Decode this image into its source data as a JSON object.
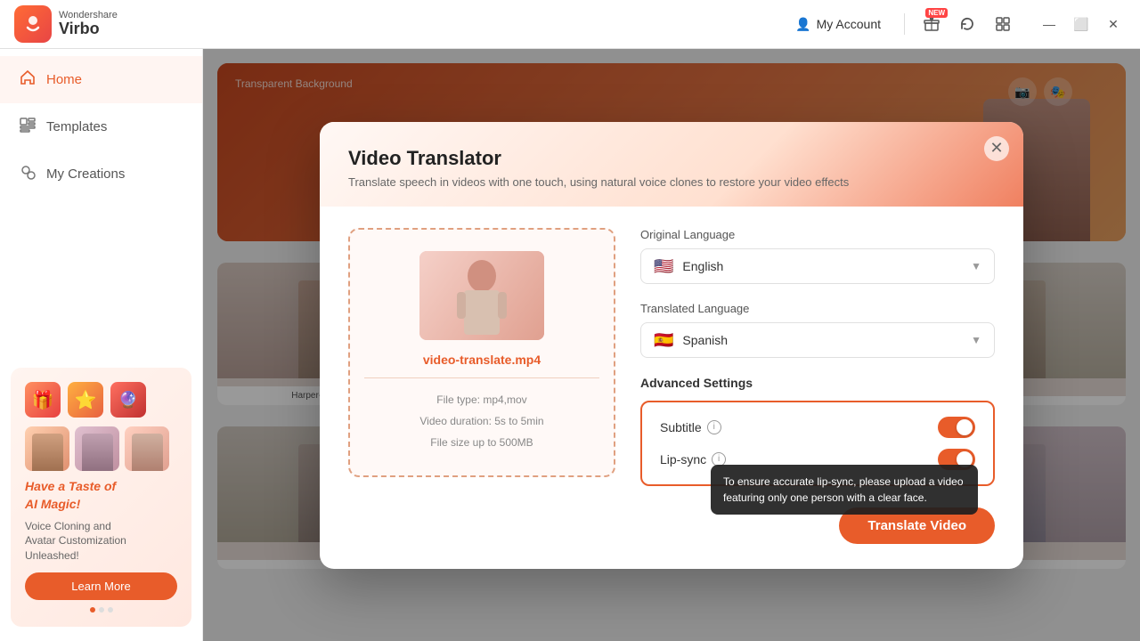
{
  "app": {
    "brand": "Wondershare",
    "name": "Virbo"
  },
  "titlebar": {
    "account_label": "My Account",
    "new_badge": "NEW",
    "icons": [
      "gift-icon",
      "reload-icon",
      "grid-icon"
    ]
  },
  "sidebar": {
    "items": [
      {
        "id": "home",
        "label": "Home",
        "active": true
      },
      {
        "id": "templates",
        "label": "Templates",
        "active": false
      },
      {
        "id": "my-creations",
        "label": "My Creations",
        "active": false
      }
    ],
    "promo": {
      "title_line1": "Have a Taste of",
      "title_line2": "AI Magic!",
      "subtitle": "Voice Cloning and\nAvatar Customization Unleashed!",
      "learn_more": "Learn More"
    }
  },
  "modal": {
    "title": "Video Translator",
    "subtitle": "Translate speech in videos with one touch, using natural voice clones to restore your video effects",
    "file": {
      "name": "video-translate.mp4",
      "type_label": "File type: mp4,mov",
      "duration_label": "Video duration: 5s to 5min",
      "size_label": "File size up to  500MB"
    },
    "original_language_label": "Original Language",
    "original_language_value": "English",
    "original_language_flag": "🇺🇸",
    "translated_language_label": "Translated Language",
    "translated_language_value": "Spanish",
    "translated_language_flag": "🇪🇸",
    "advanced_settings_label": "Advanced Settings",
    "subtitle_label": "Subtitle",
    "lipsync_label": "Lip-sync",
    "subtitle_on": true,
    "lipsync_on": true,
    "tooltip": "To ensure accurate lip-sync, please upload a video featuring only one person with a clear face.",
    "translate_btn": "Translate Video"
  },
  "bg_avatars": [
    {
      "label": "Harper-Promotion"
    }
  ]
}
